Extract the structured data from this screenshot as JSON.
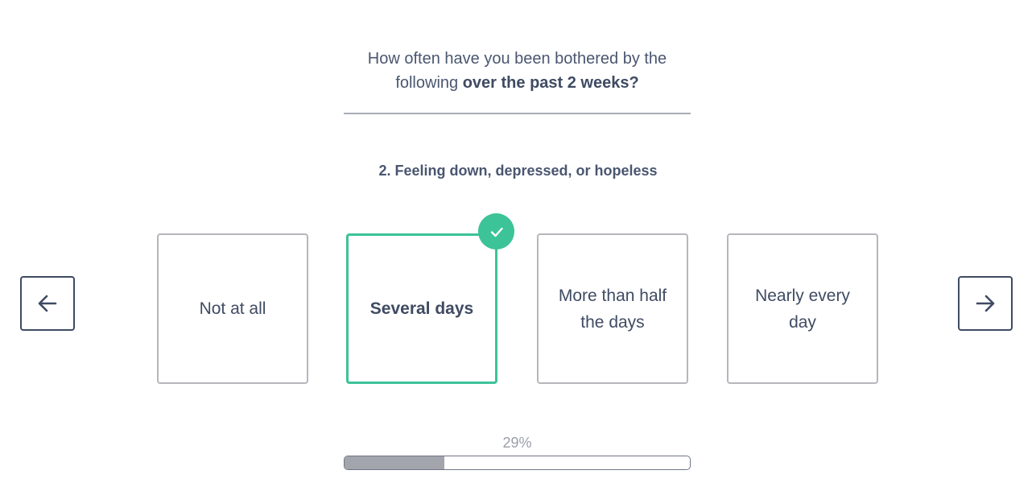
{
  "header": {
    "prompt_line1": "How often have you been bothered by the",
    "prompt_line2_prefix": "following ",
    "prompt_line2_bold": "over the past 2 weeks?"
  },
  "question": {
    "text": "2. Feeling down, depressed, or hopeless"
  },
  "options": [
    {
      "label": "Not at all",
      "selected": false
    },
    {
      "label": "Several days",
      "selected": true
    },
    {
      "label": "More than half the days",
      "selected": false
    },
    {
      "label": "Nearly every day",
      "selected": false
    }
  ],
  "navigation": {
    "prev_icon": "arrow-left-icon",
    "next_icon": "arrow-right-icon"
  },
  "progress": {
    "label": "29%",
    "value": 0.29
  },
  "colors": {
    "accent": "#3cc398",
    "text": "#3f4b63",
    "border": "#b5b7bc",
    "progress_fill": "#a2a5ab"
  }
}
